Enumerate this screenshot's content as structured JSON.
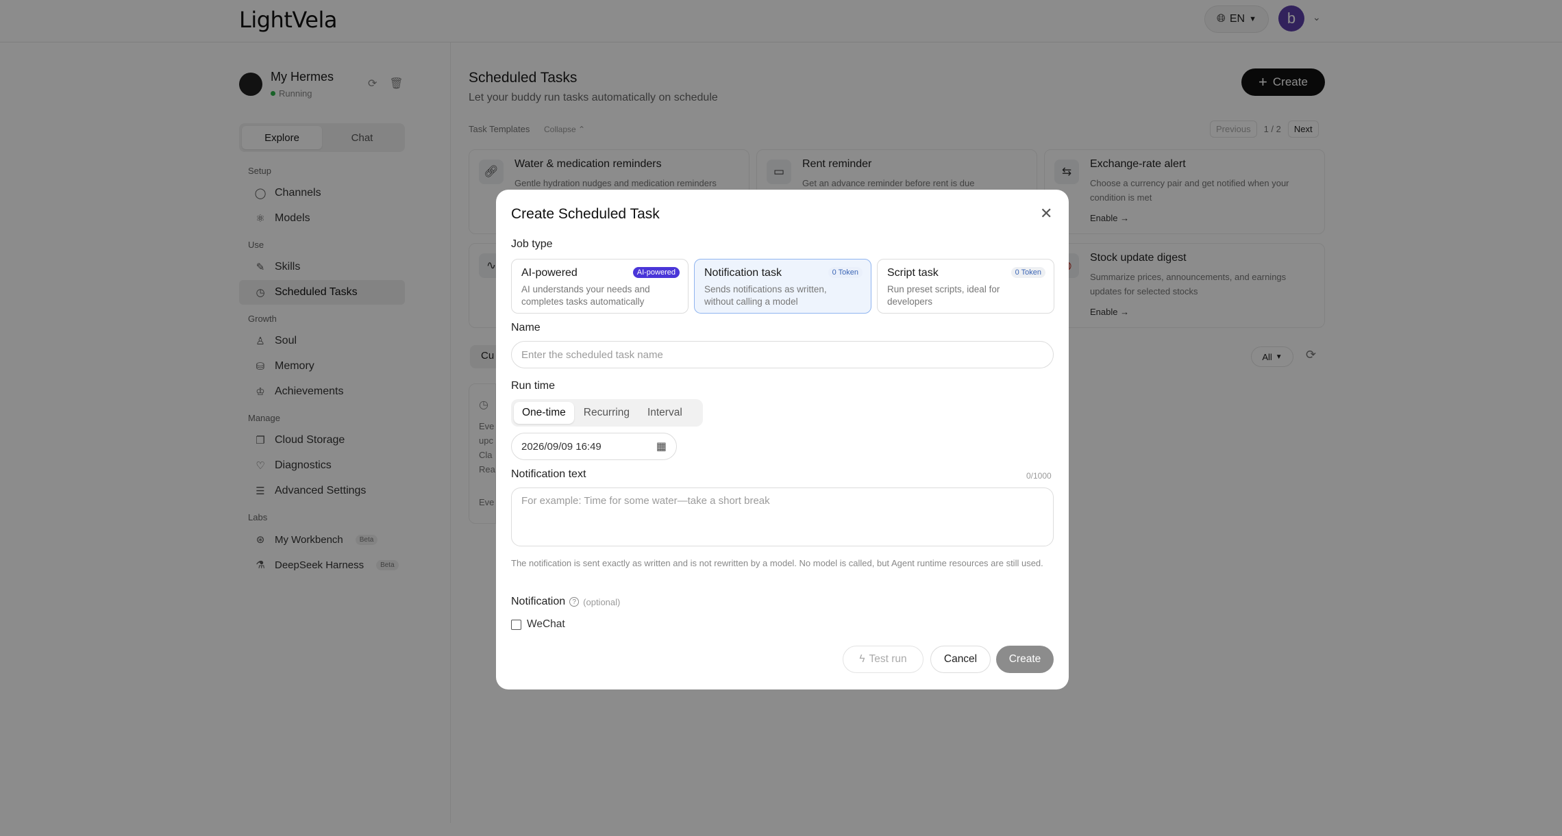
{
  "header": {
    "logo": "LightVela",
    "language": "EN",
    "user_initial": "b"
  },
  "sidebar": {
    "agent_name": "My Hermes",
    "agent_status": "Running",
    "tabs": [
      "Explore",
      "Chat"
    ],
    "sections": [
      {
        "title": "Setup",
        "items": [
          {
            "label": "Channels",
            "icon": "chat-bubble-icon"
          },
          {
            "label": "Models",
            "icon": "models-icon"
          }
        ]
      },
      {
        "title": "Use",
        "items": [
          {
            "label": "Skills",
            "icon": "magic-wand-icon"
          },
          {
            "label": "Scheduled Tasks",
            "icon": "clock-calendar-icon"
          }
        ]
      },
      {
        "title": "Growth",
        "items": [
          {
            "label": "Soul",
            "icon": "person-icon"
          },
          {
            "label": "Memory",
            "icon": "database-icon"
          },
          {
            "label": "Achievements",
            "icon": "trophy-icon"
          }
        ]
      },
      {
        "title": "Manage",
        "items": [
          {
            "label": "Cloud Storage",
            "icon": "cloud-storage-icon"
          },
          {
            "label": "Diagnostics",
            "icon": "diagnostics-icon"
          },
          {
            "label": "Advanced Settings",
            "icon": "sliders-icon"
          }
        ]
      },
      {
        "title": "Labs",
        "items": [
          {
            "label": "My Workbench",
            "icon": "workbench-icon",
            "badge": "Beta"
          },
          {
            "label": "DeepSeek Harness",
            "icon": "flask-icon",
            "badge": "Beta"
          }
        ]
      }
    ]
  },
  "main": {
    "title": "Scheduled Tasks",
    "subtitle": "Let your buddy run tasks automatically on schedule",
    "create_label": "Create",
    "templates_label": "Task Templates",
    "collapse_label": "Collapse",
    "pager": {
      "previous": "Previous",
      "page": "1 / 2",
      "next": "Next"
    },
    "cards": [
      {
        "title": "Water & medication reminders",
        "desc": "Gentle hydration nudges and medication reminders",
        "icon": "link-icon"
      },
      {
        "title": "Rent reminder",
        "desc": "Get an advance reminder before rent is due",
        "icon": "card-icon"
      },
      {
        "title": "Exchange-rate alert",
        "desc": "Choose a currency pair and get notified when your condition is met",
        "enable": "Enable →",
        "icon": "exchange-icon"
      },
      {
        "title": "Stock update digest",
        "desc": "Summarize prices, announcements, and earnings updates for selected stocks",
        "enable": "Enable →",
        "icon": "stock-icon"
      }
    ],
    "current_tab": "Cu",
    "filter": "All",
    "bg_text": [
      "Eve",
      "upc",
      "Cla",
      "Rea",
      "Eve"
    ]
  },
  "modal": {
    "title": "Create Scheduled Task",
    "job_type_label": "Job type",
    "job_types": [
      {
        "title": "AI-powered",
        "badge": "AI-powered",
        "desc": "AI understands your needs and completes tasks automatically"
      },
      {
        "title": "Notification task",
        "badge": "0 Token",
        "desc": "Sends notifications as written, without calling a model"
      },
      {
        "title": "Script task",
        "badge": "0 Token",
        "desc": "Run preset scripts, ideal for developers"
      }
    ],
    "name_label": "Name",
    "name_placeholder": "Enter the scheduled task name",
    "run_time_label": "Run time",
    "run_time_options": [
      "One-time",
      "Recurring",
      "Interval"
    ],
    "datetime": "2026/09/09 16:49",
    "notification_text_label": "Notification text",
    "counter": "0/1000",
    "notification_placeholder": "For example: Time for some water—take a short break",
    "hint": "The notification is sent exactly as written and is not rewritten by a model. No model is called, but Agent runtime resources are still used.",
    "notification_label": "Notification",
    "optional_label": "(optional)",
    "wechat_label": "WeChat",
    "test_run_label": "Test run",
    "cancel_label": "Cancel",
    "create_label": "Create"
  }
}
